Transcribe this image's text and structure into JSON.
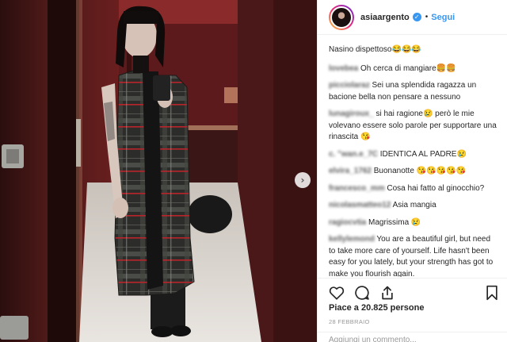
{
  "post": {
    "username": "asiaargento",
    "verified": "✓",
    "separator": "•",
    "follow_label": "Segui",
    "caption": "Nasino dispettoso😂😂😂"
  },
  "comments": [
    {
      "user": "lovebea",
      "text": "Oh cerca di mangiare🍔🍔"
    },
    {
      "user": "picciolaraz",
      "text": "Sei una splendida ragazza un bacione bella non pensare a nessuno"
    },
    {
      "user": "lunagiroux_",
      "text": "si hai ragione😢 però le mie volevano essere solo parole per supportare una rinascita 😘"
    },
    {
      "user": "c. \"wan.e_7C",
      "text": "IDENTICA AL PADRE😢"
    },
    {
      "user": "elvira_1762",
      "text": "Buonanotte 😘😘😘😘😘"
    },
    {
      "user": "francesco_mm",
      "text": "Cosa hai fatto al ginocchio?"
    },
    {
      "user": "nicolasmatteo12",
      "text": "Asia mangia"
    },
    {
      "user": "ragiocvtia",
      "text": "Magrissima 😢"
    },
    {
      "user": "kellylemond",
      "text": "You are a beautiful girl, but need to take more care of yourself. Life hasn't been easy for you lately, but your strength has got to make you flourish again."
    }
  ],
  "likes": "Piace a 20.825 persone",
  "date": "28 FEBBRAIO",
  "add_comment_placeholder": "Aggiungi un commento...",
  "icons": {
    "like": "heart-icon",
    "comment": "comment-icon",
    "share": "share-icon",
    "save": "bookmark-icon",
    "next": "chevron-right-icon"
  },
  "colors": {
    "link": "#3897f0",
    "text": "#262626",
    "muted": "#999999",
    "coat_red": "#b8242a",
    "room_red": "#6e1a1c"
  },
  "next_arrow_glyph": "›"
}
